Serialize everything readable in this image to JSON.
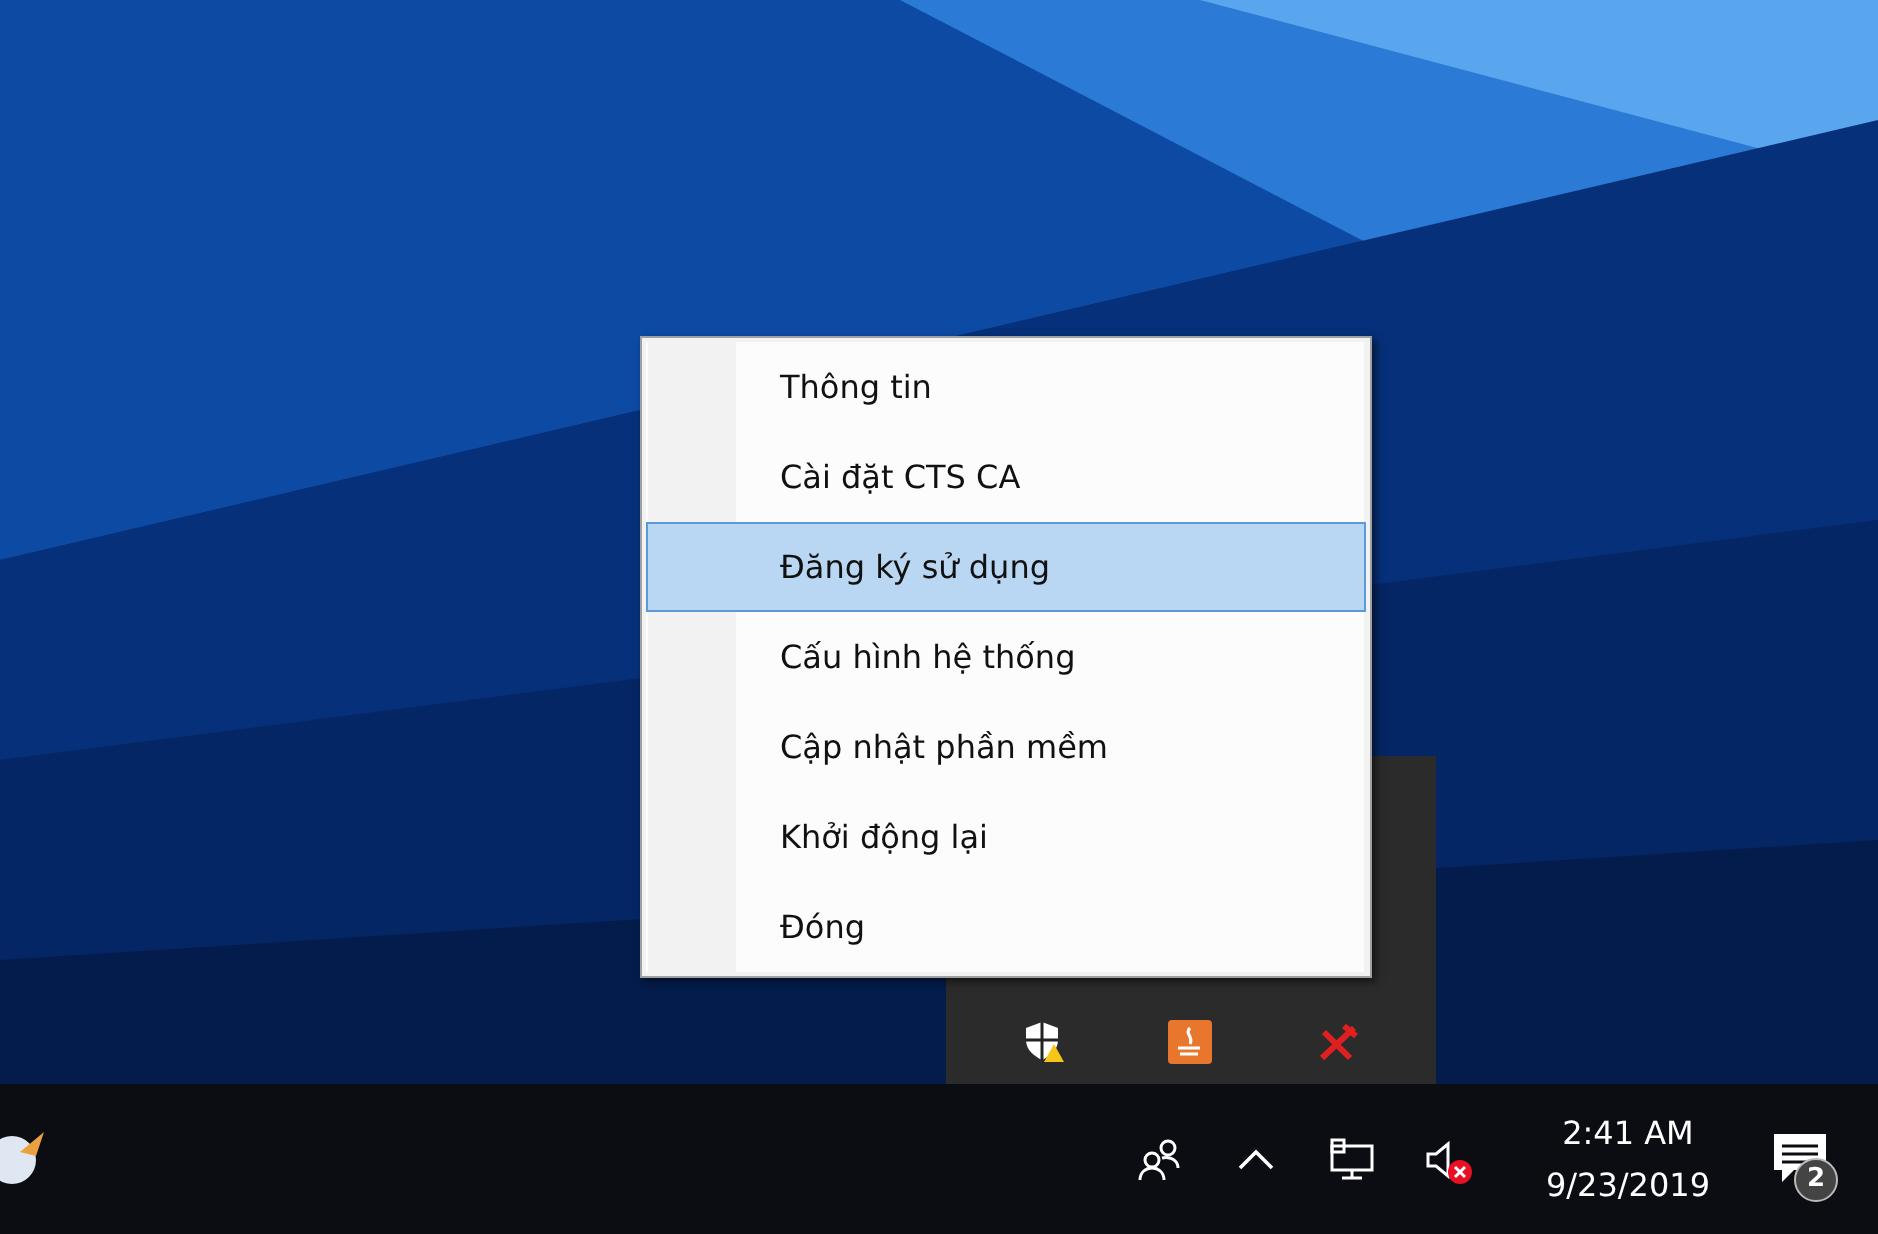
{
  "context_menu": {
    "items": [
      {
        "label": "Thông tin",
        "selected": false
      },
      {
        "label": "Cài đặt CTS CA",
        "selected": false
      },
      {
        "label": "Đăng ký sử dụng",
        "selected": true
      },
      {
        "label": "Cấu hình hệ thống",
        "selected": false
      },
      {
        "label": "Cập nhật phần mềm",
        "selected": false
      },
      {
        "label": "Khởi động lại",
        "selected": false
      },
      {
        "label": "Đóng",
        "selected": false
      }
    ]
  },
  "taskbar": {
    "clock": {
      "time": "2:41 AM",
      "date": "9/23/2019"
    },
    "notifications": {
      "count": "2"
    }
  }
}
